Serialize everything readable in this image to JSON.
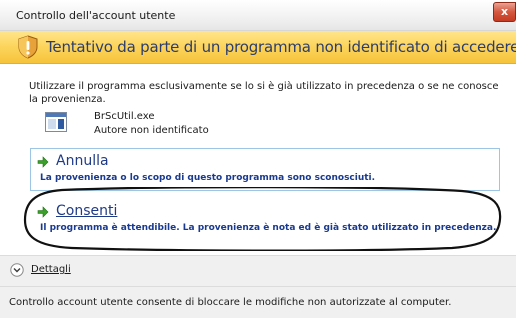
{
  "window": {
    "title": "Controllo dell'account utente",
    "close_label": "x"
  },
  "banner": {
    "icon": "uac-shield-icon",
    "text": "Tentativo da parte di un programma non identificato di accedere al computer"
  },
  "description": "Utilizzare il programma esclusivamente se lo si è già utilizzato in precedenza o se ne conosce la provenienza.",
  "program": {
    "icon": "program-window-icon",
    "name": "BrScUtil.exe",
    "publisher": "Autore non identificato"
  },
  "options": [
    {
      "icon": "green-arrow-icon",
      "title": "Annulla",
      "subtitle": "La provenienza o lo scopo di questo programma sono sconosciuti."
    },
    {
      "icon": "green-arrow-icon",
      "title": "Consenti",
      "subtitle": "Il programma è attendibile. La provenienza è nota ed è già stato utilizzato in precedenza."
    }
  ],
  "details": {
    "icon": "chevron-down-icon",
    "label": "Dettagli"
  },
  "footer": {
    "text": "Controllo account utente consente di bloccare le modifiche non autorizzate al computer."
  },
  "colors": {
    "banner": "#fcd45b",
    "option_border": "#9cc6e3",
    "option_text": "#1f3b86",
    "close_button": "#d5573f",
    "arrow": "#3aa02a"
  }
}
